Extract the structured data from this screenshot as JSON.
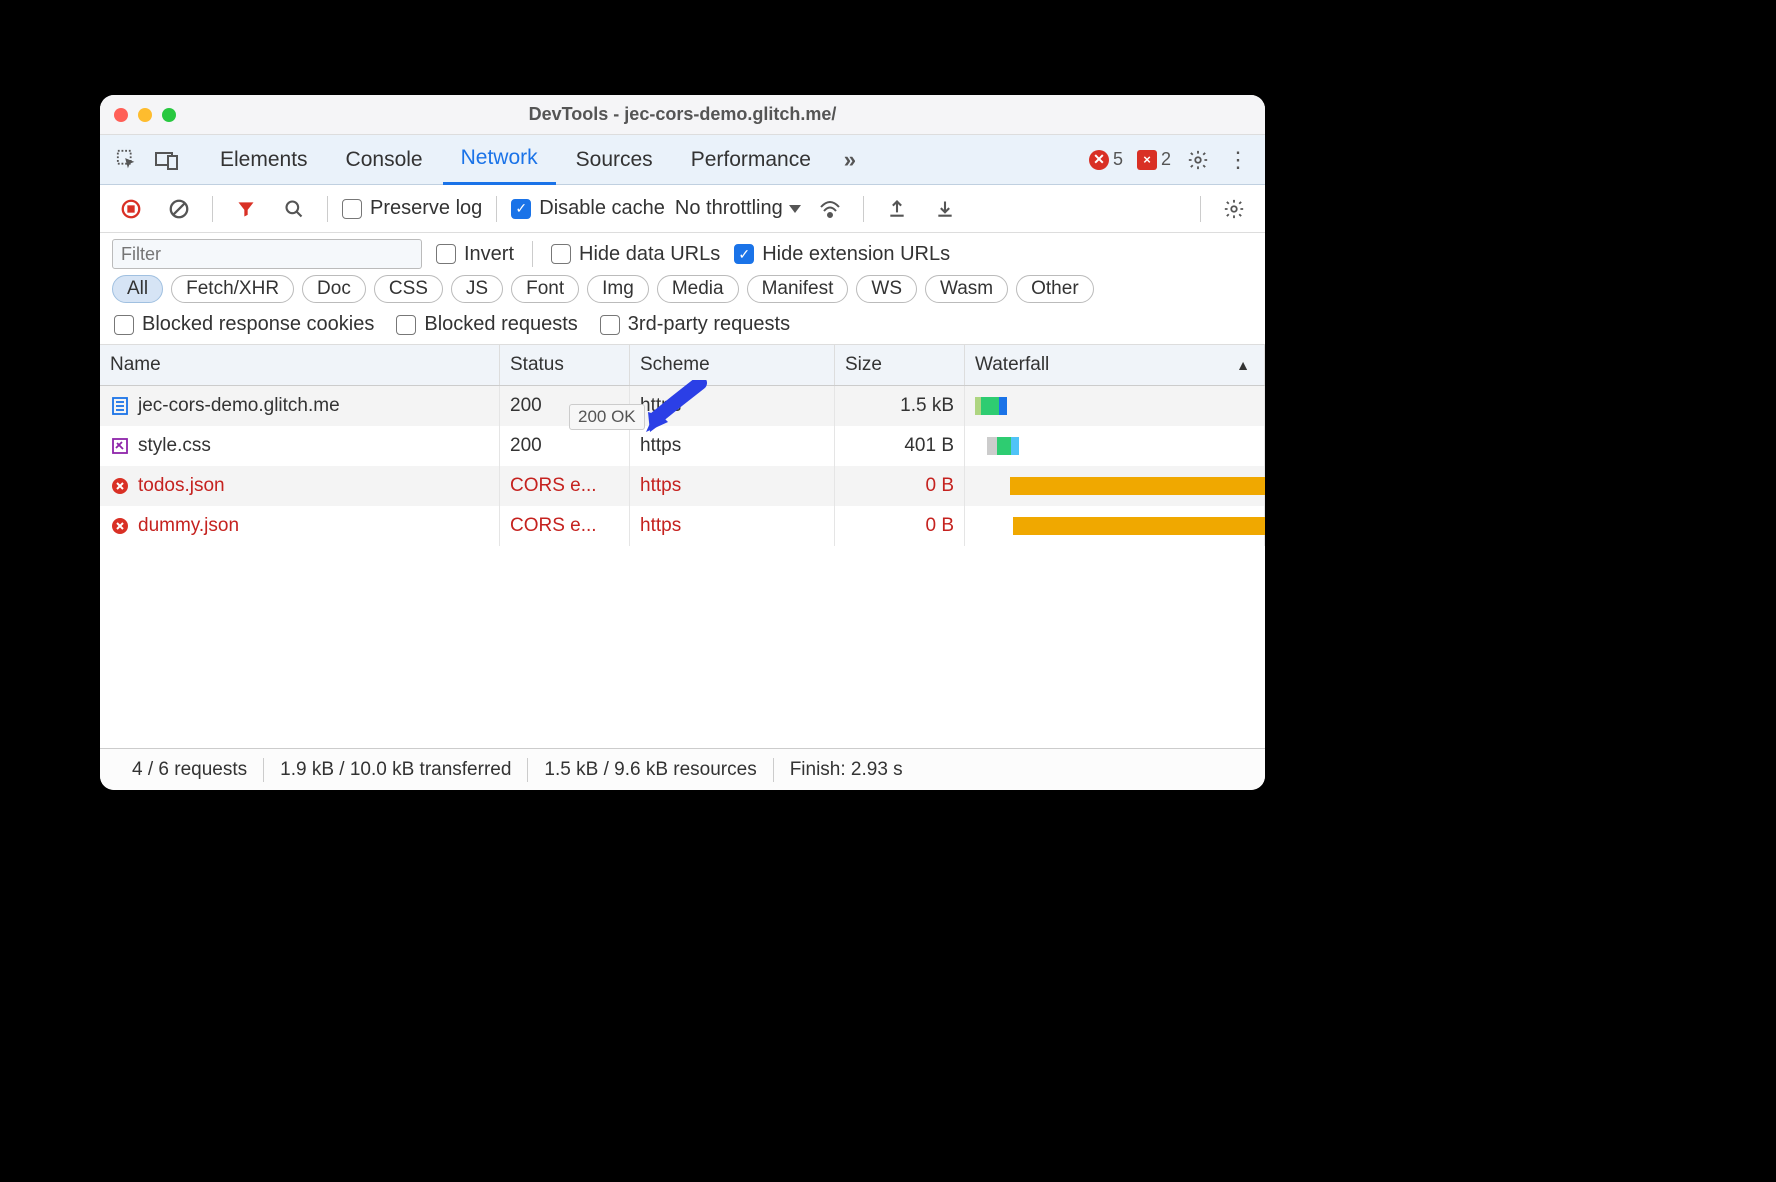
{
  "window_title": "DevTools - jec-cors-demo.glitch.me/",
  "tabs": {
    "elements": "Elements",
    "console": "Console",
    "network": "Network",
    "sources": "Sources",
    "performance": "Performance"
  },
  "badge_error_count": "5",
  "badge_issue_count": "2",
  "toolbar": {
    "preserve_log": "Preserve log",
    "disable_cache": "Disable cache",
    "throttling": "No throttling"
  },
  "filter": {
    "placeholder": "Filter",
    "invert": "Invert",
    "hide_data_urls": "Hide data URLs",
    "hide_ext_urls": "Hide extension URLs"
  },
  "type_filters": [
    "All",
    "Fetch/XHR",
    "Doc",
    "CSS",
    "JS",
    "Font",
    "Img",
    "Media",
    "Manifest",
    "WS",
    "Wasm",
    "Other"
  ],
  "extra_checks": {
    "blocked_cookies": "Blocked response cookies",
    "blocked_requests": "Blocked requests",
    "third_party": "3rd-party requests"
  },
  "columns": {
    "name": "Name",
    "status": "Status",
    "scheme": "Scheme",
    "size": "Size",
    "waterfall": "Waterfall"
  },
  "rows": [
    {
      "name": "jec-cors-demo.glitch.me",
      "status": "200",
      "scheme": "https",
      "size": "1.5 kB",
      "error": false,
      "icon": "document"
    },
    {
      "name": "style.css",
      "status": "200",
      "scheme": "https",
      "size": "401 B",
      "error": false,
      "icon": "css"
    },
    {
      "name": "todos.json",
      "status": "CORS e...",
      "scheme": "https",
      "size": "0 B",
      "error": true,
      "icon": "error"
    },
    {
      "name": "dummy.json",
      "status": "CORS e...",
      "scheme": "https",
      "size": "0 B",
      "error": true,
      "icon": "error"
    }
  ],
  "tooltip": "200 OK",
  "status": {
    "requests": "4 / 6 requests",
    "transferred": "1.9 kB / 10.0 kB transferred",
    "resources": "1.5 kB / 9.6 kB resources",
    "finish": "Finish: 2.93 s"
  }
}
